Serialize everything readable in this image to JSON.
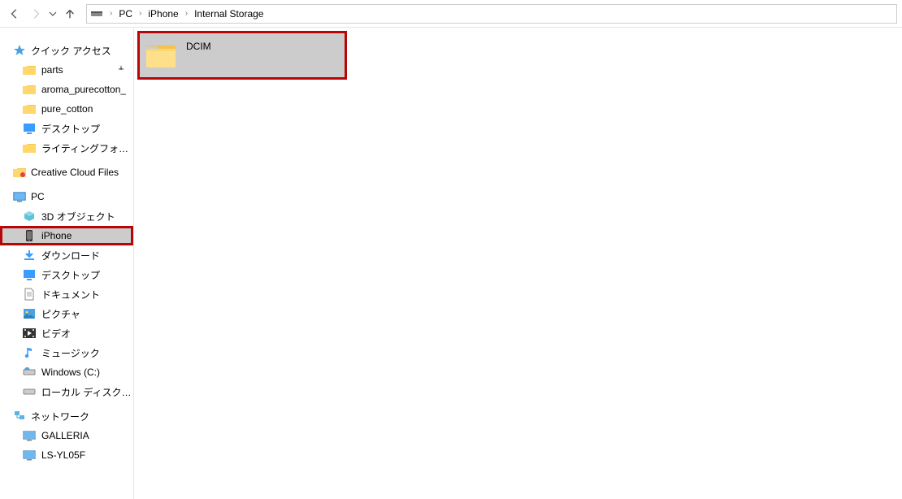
{
  "breadcrumb": [
    "PC",
    "iPhone",
    "Internal Storage"
  ],
  "sidebar": {
    "quickAccess": {
      "label": "クイック アクセス",
      "items": [
        {
          "label": "parts",
          "icon": "folder",
          "pinned": true
        },
        {
          "label": "aroma_purecotton_",
          "icon": "folder"
        },
        {
          "label": "pure_cotton",
          "icon": "folder"
        },
        {
          "label": "デスクトップ",
          "icon": "desktop-blue"
        },
        {
          "label": "ライティングフォルダ",
          "icon": "folder"
        }
      ]
    },
    "creativeCloud": {
      "label": "Creative Cloud Files"
    },
    "pc": {
      "label": "PC",
      "items": [
        {
          "label": "3D オブジェクト",
          "icon": "cube"
        },
        {
          "label": "iPhone",
          "icon": "phone",
          "selected": true,
          "highlighted": true
        },
        {
          "label": "ダウンロード",
          "icon": "download"
        },
        {
          "label": "デスクトップ",
          "icon": "desktop-blue"
        },
        {
          "label": "ドキュメント",
          "icon": "document"
        },
        {
          "label": "ピクチャ",
          "icon": "pictures"
        },
        {
          "label": "ビデオ",
          "icon": "video"
        },
        {
          "label": "ミュージック",
          "icon": "music"
        },
        {
          "label": "Windows (C:)",
          "icon": "drive"
        },
        {
          "label": "ローカル ディスク (D:)",
          "icon": "drive"
        }
      ]
    },
    "network": {
      "label": "ネットワーク",
      "items": [
        {
          "label": "GALLERIA",
          "icon": "monitor"
        },
        {
          "label": "LS-YL05F",
          "icon": "monitor"
        }
      ]
    }
  },
  "content": {
    "folder": {
      "label": "DCIM"
    }
  }
}
